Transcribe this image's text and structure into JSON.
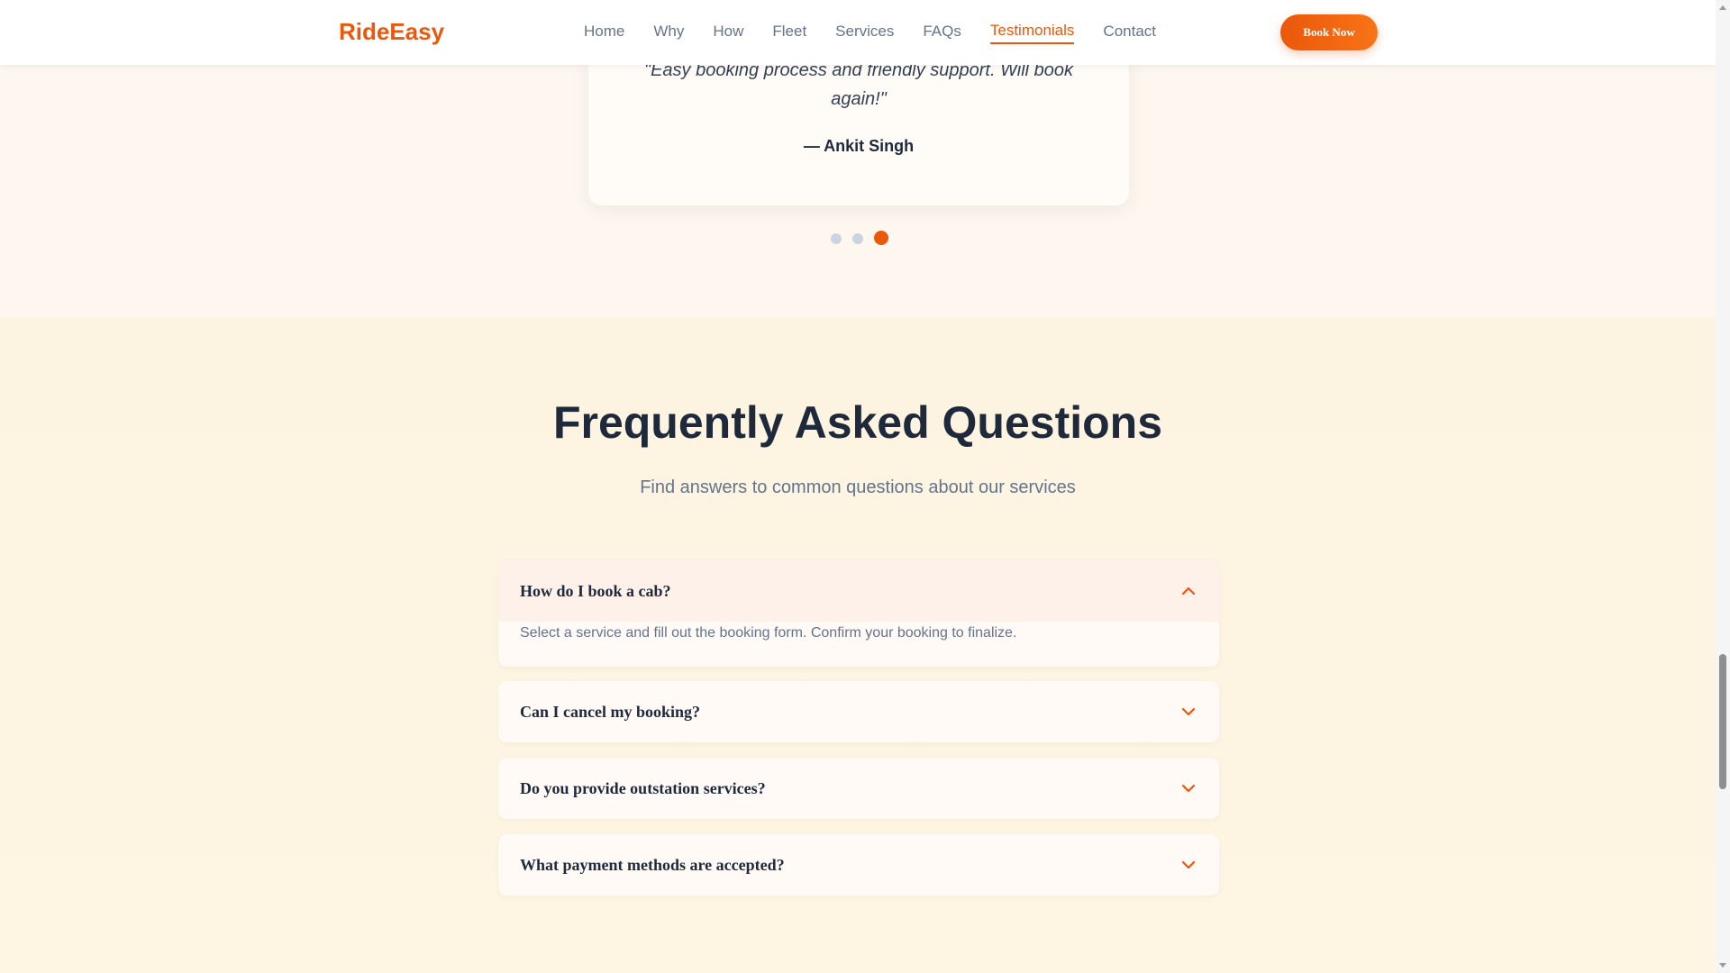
{
  "header": {
    "logo": "RideEasy",
    "nav": [
      {
        "label": "Home",
        "active": false
      },
      {
        "label": "Why",
        "active": false
      },
      {
        "label": "How",
        "active": false
      },
      {
        "label": "Fleet",
        "active": false
      },
      {
        "label": "Services",
        "active": false
      },
      {
        "label": "FAQs",
        "active": false
      },
      {
        "label": "Testimonials",
        "active": true
      },
      {
        "label": "Contact",
        "active": false
      }
    ],
    "cta_label": "Book Now"
  },
  "testimonial": {
    "quote": "\"Easy booking process and friendly support. Will book again!\"",
    "author": "— Ankit Singh",
    "slide_count": 3,
    "active_slide": 3
  },
  "faq": {
    "title": "Frequently Asked Questions",
    "subtitle": "Find answers to common questions about our services",
    "items": [
      {
        "question": "How do I book a cab?",
        "answer": "Select a service and fill out the booking form. Confirm your booking to finalize.",
        "open": true
      },
      {
        "question": "Can I cancel my booking?",
        "open": false
      },
      {
        "question": "Do you provide outstation services?",
        "open": false
      },
      {
        "question": "What payment methods are accepted?",
        "open": false
      }
    ]
  },
  "colors": {
    "accent": "#ea580c",
    "text_dark": "#1e293b",
    "text_muted": "#64748b"
  }
}
